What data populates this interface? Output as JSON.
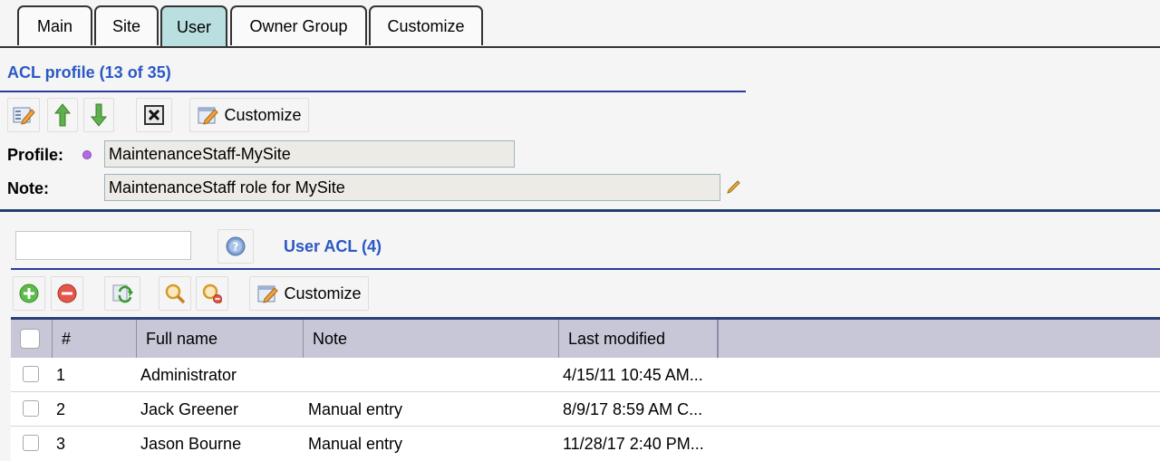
{
  "tabs": [
    {
      "label": "Main"
    },
    {
      "label": "Site"
    },
    {
      "label": "User"
    },
    {
      "label": "Owner Group"
    },
    {
      "label": "Customize"
    }
  ],
  "acl_profile": {
    "title": "ACL profile (13 of 35)",
    "toolbar": {
      "customize_label": "Customize"
    },
    "profile_label": "Profile:",
    "profile_value": "MaintenanceStaff-MySite",
    "note_label": "Note:",
    "note_value": "MaintenanceStaff role for MySite"
  },
  "user_acl": {
    "title": "User ACL (4)",
    "search_value": "",
    "toolbar": {
      "customize_label": "Customize"
    },
    "columns": [
      "#",
      "Full name",
      "Note",
      "Last modified"
    ],
    "rows": [
      {
        "num": "1",
        "full_name": "Administrator",
        "note": "",
        "last_modified": "4/15/11 10:45 AM..."
      },
      {
        "num": "2",
        "full_name": "Jack Greener",
        "note": "Manual entry",
        "last_modified": "8/9/17 8:59 AM C..."
      },
      {
        "num": "3",
        "full_name": "Jason Bourne",
        "note": "Manual entry",
        "last_modified": "11/28/17 2:40 PM..."
      }
    ]
  },
  "colors": {
    "active_tab": "#b9dfe0",
    "section_title": "#2b58c4",
    "table_header": "#c7c7d8"
  }
}
